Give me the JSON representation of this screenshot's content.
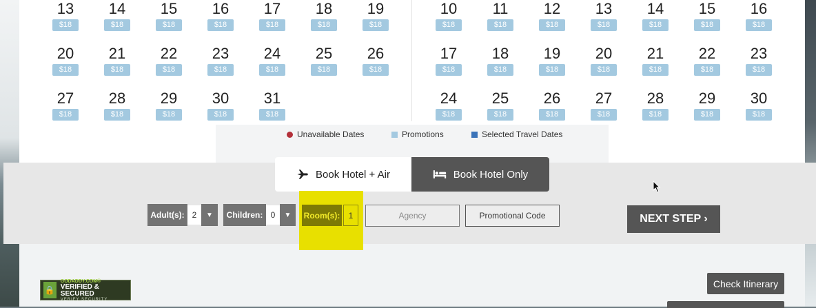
{
  "calendar_left": {
    "weeks": [
      [
        "13",
        "14",
        "15",
        "16",
        "17",
        "18",
        "19"
      ],
      [
        "20",
        "21",
        "22",
        "23",
        "24",
        "25",
        "26"
      ],
      [
        "27",
        "28",
        "29",
        "30",
        "31"
      ]
    ],
    "price": "$18"
  },
  "calendar_right": {
    "weeks": [
      [
        "10",
        "11",
        "12",
        "13",
        "14",
        "15",
        "16"
      ],
      [
        "17",
        "18",
        "19",
        "20",
        "21",
        "22",
        "23"
      ],
      [
        "24",
        "25",
        "26",
        "27",
        "28",
        "29",
        "30"
      ]
    ],
    "price": "$18"
  },
  "legend": {
    "unavailable": "Unavailable Dates",
    "promotions": "Promotions",
    "selected": "Selected Travel Dates"
  },
  "tabs": {
    "hotel_air": "Book Hotel + Air",
    "hotel_only": "Book Hotel Only"
  },
  "controls": {
    "adults_label": "Adult(s):",
    "adults_value": "2",
    "children_label": "Children:",
    "children_value": "0",
    "rooms_label": "Room(s):",
    "rooms_value": "1",
    "agency_placeholder": "Agency",
    "promo_label": "Promotional Code",
    "next_label": "NEXT STEP ›"
  },
  "footer": {
    "check_itinerary": "Check Itinerary",
    "seal_top": "GODADDY.COM®",
    "seal_mid": "VERIFIED & SECURED",
    "seal_bot": "VERIFY SECURITY"
  },
  "colors": {
    "promo_price_bg": "#a3c9e0",
    "unavailable_dot": "#b3303a",
    "selected_square": "#3b73b9",
    "highlight": "#e8e000"
  },
  "icons": {
    "air_tab": "plane-icon",
    "hotel_tab": "bed-icon"
  }
}
